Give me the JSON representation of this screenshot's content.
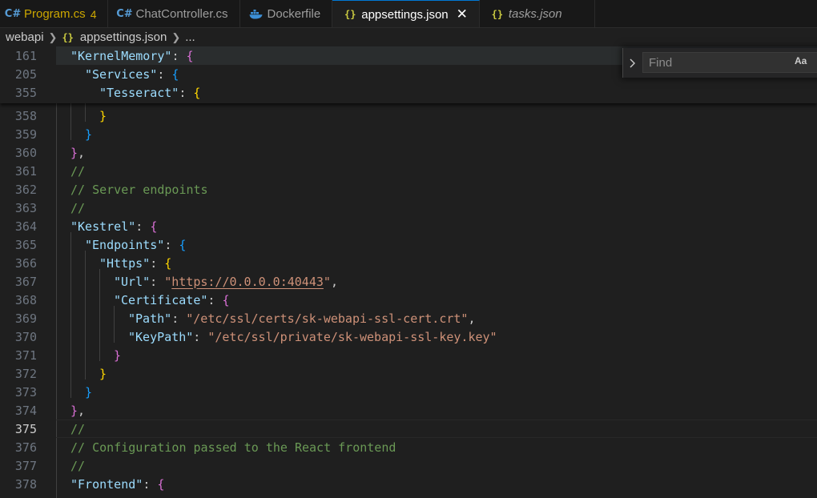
{
  "tabs": [
    {
      "label": "Program.cs",
      "icon": "csharp-icon",
      "count": "4",
      "modified": true
    },
    {
      "label": "ChatController.cs",
      "icon": "csharp-icon"
    },
    {
      "label": "Dockerfile",
      "icon": "docker-icon"
    },
    {
      "label": "appsettings.json",
      "icon": "json-icon",
      "active": true
    },
    {
      "label": "tasks.json",
      "icon": "json-icon",
      "italic": true
    }
  ],
  "breadcrumb": {
    "folder": "webapi",
    "file": "appsettings.json",
    "more": "..."
  },
  "find": {
    "placeholder": "Find",
    "match_case_label": "Aa"
  },
  "editor": {
    "current_line": "375",
    "sticky": [
      {
        "num": "161",
        "key": "\"KernelMemory\""
      },
      {
        "num": "205",
        "key": "\"Services\""
      },
      {
        "num": "355",
        "key": "\"Tesseract\""
      }
    ],
    "lines": [
      {
        "num": "358"
      },
      {
        "num": "359"
      },
      {
        "num": "360"
      },
      {
        "num": "361",
        "comment": "//"
      },
      {
        "num": "362",
        "comment": "// Server endpoints"
      },
      {
        "num": "363",
        "comment": "//"
      },
      {
        "num": "364",
        "key": "\"Kestrel\""
      },
      {
        "num": "365",
        "key": "\"Endpoints\""
      },
      {
        "num": "366",
        "key": "\"Https\""
      },
      {
        "num": "367",
        "key": "\"Url\"",
        "value": "https://0.0.0.0:40443"
      },
      {
        "num": "368",
        "key": "\"Certificate\""
      },
      {
        "num": "369",
        "key": "\"Path\"",
        "value": "\"/etc/ssl/certs/sk-webapi-ssl-cert.crt\""
      },
      {
        "num": "370",
        "key": "\"KeyPath\"",
        "value": "\"/etc/ssl/private/sk-webapi-ssl-key.key\""
      },
      {
        "num": "371"
      },
      {
        "num": "372"
      },
      {
        "num": "373"
      },
      {
        "num": "374"
      },
      {
        "num": "375",
        "comment": "//"
      },
      {
        "num": "376",
        "comment": "// Configuration passed to the React frontend"
      },
      {
        "num": "377",
        "comment": "//"
      },
      {
        "num": "378",
        "key": "\"Frontend\""
      }
    ]
  }
}
